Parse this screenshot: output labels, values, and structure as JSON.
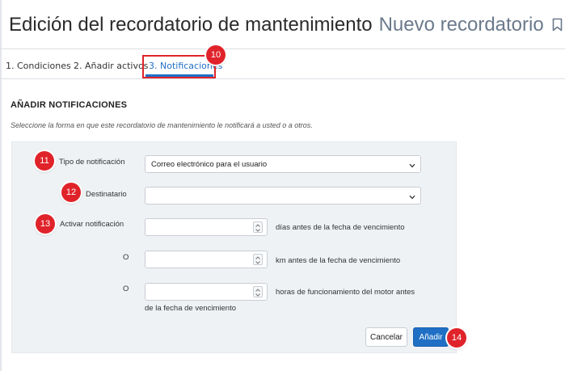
{
  "header": {
    "title": "Edición del recordatorio de mantenimiento",
    "subtitle": "Nuevo recordatorio"
  },
  "tabs": [
    {
      "label": "1. Condiciones",
      "active": false
    },
    {
      "label": "2. Añadir activos",
      "active": false
    },
    {
      "label": "3. Notificaciones",
      "active": true
    }
  ],
  "section": {
    "title": "AÑADIR NOTIFICACIONES",
    "description": "Seleccione la forma en que este recordatorio de mantenimiento le notificará a usted o a otros."
  },
  "form": {
    "notification_type_label": "Tipo de notificación",
    "notification_type_value": "Correo electrónico para el usuario",
    "recipient_label": "Destinatario",
    "recipient_value": "",
    "activate_label": "Activar notificación",
    "or_label": "O",
    "days_value": "",
    "days_unit": "días antes de la fecha de vencimiento",
    "km_value": "",
    "km_unit": "km antes de la fecha de vencimiento",
    "hours_value": "",
    "hours_unit_line1": "horas de funcionamiento del motor antes",
    "hours_unit_line2": "de la fecha de vencimiento"
  },
  "buttons": {
    "cancel": "Cancelar",
    "add": "Añadir"
  },
  "callouts": [
    "10",
    "11",
    "12",
    "13",
    "14"
  ],
  "colors": {
    "accent": "#1f6fc5",
    "callout": "#e0232a",
    "panel_bg": "#eff2f5"
  },
  "icons": {
    "bookmark": "bookmark-icon",
    "chevron": "chevron-down-icon",
    "spinner": "spinner-arrows-icon"
  }
}
